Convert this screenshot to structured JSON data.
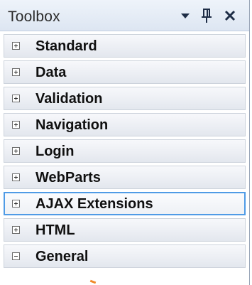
{
  "toolbox": {
    "title": "Toolbox",
    "buttons": {
      "dropdown": "chevron-down-icon",
      "pin": "pin-icon",
      "close": "close-icon"
    },
    "tabs": [
      {
        "label": "Standard",
        "state": "collapsed"
      },
      {
        "label": "Data",
        "state": "collapsed"
      },
      {
        "label": "Validation",
        "state": "collapsed"
      },
      {
        "label": "Navigation",
        "state": "collapsed"
      },
      {
        "label": "Login",
        "state": "collapsed"
      },
      {
        "label": "WebParts",
        "state": "collapsed"
      },
      {
        "label": "AJAX Extensions",
        "state": "collapsed",
        "selected": true
      },
      {
        "label": "HTML",
        "state": "collapsed"
      },
      {
        "label": "General",
        "state": "expanded"
      }
    ]
  },
  "colors": {
    "selection_border": "#4f9be6",
    "title_text": "#2a2a2a",
    "header_bg": "#e6edf7"
  }
}
